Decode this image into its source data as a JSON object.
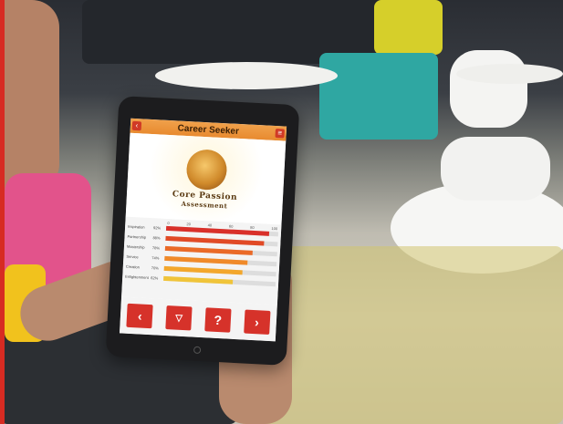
{
  "app": {
    "title": "Career Seeker",
    "logo_line1": "Core Passion",
    "logo_line2": "Assessment"
  },
  "chart_data": {
    "type": "bar",
    "tick_labels": [
      "0",
      "20",
      "40",
      "60",
      "80",
      "100"
    ],
    "bars": [
      {
        "label": "Inspiration",
        "value": 92,
        "color": "#d9302a"
      },
      {
        "label": "Partnership",
        "value": 88,
        "color": "#e14a26"
      },
      {
        "label": "Mastership",
        "value": 78,
        "color": "#ea6a28"
      },
      {
        "label": "Service",
        "value": 74,
        "color": "#f08a2a"
      },
      {
        "label": "Creation",
        "value": 70,
        "color": "#f3a72c"
      },
      {
        "label": "Enlightenment",
        "value": 62,
        "color": "#f0c43a"
      }
    ]
  },
  "nav": {
    "prev_label": "‹",
    "help_label": "?",
    "next_label": "›"
  },
  "icons": {
    "logo": "core-passion-logo-icon",
    "menu": "menu-icon",
    "home": "home-emblem-icon"
  }
}
